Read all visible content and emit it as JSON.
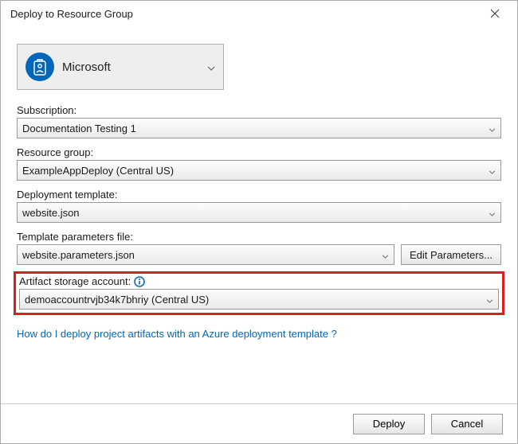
{
  "title": "Deploy to Resource Group",
  "account": {
    "name": "Microsoft"
  },
  "labels": {
    "subscription": "Subscription:",
    "resource_group": "Resource group:",
    "deployment_template": "Deployment template:",
    "template_params": "Template parameters file:",
    "artifact_storage": "Artifact storage account:"
  },
  "values": {
    "subscription": "Documentation Testing 1",
    "resource_group": "ExampleAppDeploy (Central US)",
    "deployment_template": "website.json",
    "template_params": "website.parameters.json",
    "artifact_storage": "demoaccountrvjb34k7bhriy (Central US)"
  },
  "buttons": {
    "edit_parameters": "Edit Parameters...",
    "deploy": "Deploy",
    "cancel": "Cancel"
  },
  "help_link": "How do I deploy project artifacts with an Azure deployment template ?"
}
